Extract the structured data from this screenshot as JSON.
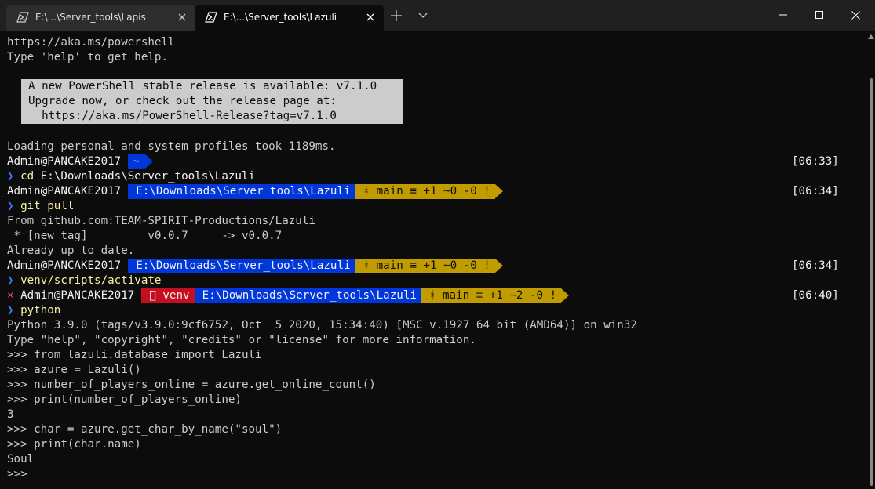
{
  "tabs": [
    {
      "title": "E:\\...\\Server_tools\\Lapis",
      "active": false
    },
    {
      "title": "E:\\...\\Server_tools\\Lazuli",
      "active": true
    }
  ],
  "icons": {
    "tab_icon": "powershell-icon",
    "close": "close-icon",
    "new_tab": "plus-icon",
    "dropdown": "chevron-down-icon",
    "minimize": "minimize-icon",
    "maximize": "maximize-icon",
    "window_close": "close-icon"
  },
  "terminal": {
    "intro": [
      "https://aka.ms/powershell",
      "Type 'help' to get help."
    ],
    "banner": [
      "A new PowerShell stable release is available: v7.1.0",
      "Upgrade now, or check out the release page at:",
      "  https://aka.ms/PowerShell-Release?tag=v7.1.0"
    ],
    "loading": "Loading personal and system profiles took 1189ms.",
    "prompt_user": "Admin@PANCAKE2017",
    "prompt_home": "~",
    "path": "E:\\Downloads\\Server_tools\\Lazuli",
    "git_status_1": "ᚼ main ≡ +1 ~0 -0 !",
    "git_status_2": "ᚼ main ≡ +1 ~2 -0 !",
    "venv": " venv",
    "chevron": "❯",
    "error_mark": "×",
    "times": [
      "[06:33]",
      "[06:34]",
      "[06:34]",
      "[06:40]"
    ],
    "cmd_cd": "cd",
    "cmd_cd_arg": " E:\\Downloads\\Server_tools\\Lazuli",
    "cmd_git": "git pull",
    "git_output": [
      "From github.com:TEAM-SPIRIT-Productions/Lazuli",
      " * [new tag]         v0.0.7     -> v0.0.7",
      "Already up to date."
    ],
    "cmd_venv": "venv/scripts/activate",
    "cmd_python": "python",
    "python_output": [
      "Python 3.9.0 (tags/v3.9.0:9cf6752, Oct  5 2020, 15:34:40) [MSC v.1927 64 bit (AMD64)] on win32",
      "Type \"help\", \"copyright\", \"credits\" or \"license\" for more information.",
      ">>> from lazuli.database import Lazuli",
      ">>> azure = Lazuli()",
      ">>> number_of_players_online = azure.get_online_count()",
      ">>> print(number_of_players_online)",
      "3",
      ">>> char = azure.get_char_by_name(\"soul\")",
      ">>> print(char.name)",
      "Soul",
      ">>> "
    ]
  },
  "colors": {
    "background": "#0c0c0c",
    "path_segment": "#0037da",
    "git_segment": "#c19c00",
    "venv_segment": "#c50f1f",
    "banner": "#cccccc"
  }
}
